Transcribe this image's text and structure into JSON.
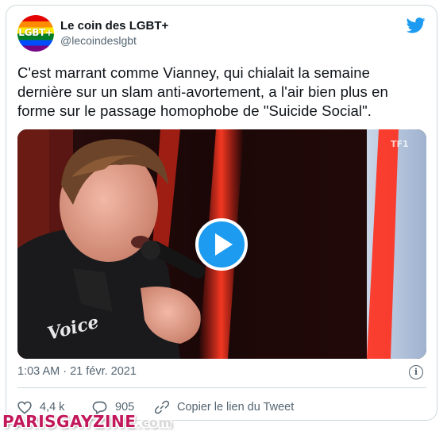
{
  "tweet": {
    "avatar_text": "LGBT+",
    "display_name": "Le coin des LGBT+",
    "handle": "@lecoindeslgbt",
    "text": "C'est marrant comme Vianney, qui chialait la semaine dernière sur un slam anti-avortement, a l'air bien plus en forme sur le passage homophobe de \"Suicide Social\".",
    "media": {
      "shirt_logo_text": "Voice",
      "channel_logo": "TF1"
    },
    "timestamp": "1:03 AM · 21 févr. 2021",
    "likes": "4,4 k",
    "replies": "905",
    "copy_link_label": "Copier le lien du Tweet"
  },
  "watermark": {
    "main": "PARISGAYZINE",
    "suffix": ".com"
  },
  "icons": {
    "brand": "twitter-bird-icon",
    "like": "heart-icon",
    "reply": "reply-bubble-icon",
    "copy": "link-icon",
    "info": "info-icon",
    "play": "play-icon"
  },
  "colors": {
    "twitter_blue": "#1d9bf0",
    "text": "#0f1419",
    "secondary_text": "#536471",
    "border": "#cfd9de",
    "watermark": "#c2185b"
  }
}
